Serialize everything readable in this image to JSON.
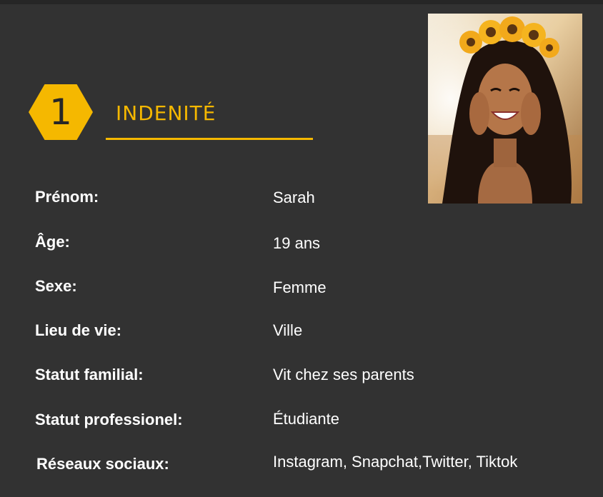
{
  "section": {
    "number": "1",
    "title": "INDENITÉ"
  },
  "colors": {
    "background": "#323232",
    "accent": "#f5b800",
    "text": "#ffffff"
  },
  "photo": {
    "icon": "portrait-photo-icon"
  },
  "fields": [
    {
      "label": "Prénom:",
      "value": "Sarah"
    },
    {
      "label": "Âge:",
      "value": "19 ans"
    },
    {
      "label": "Sexe:",
      "value": "Femme"
    },
    {
      "label": "Lieu de vie:",
      "value": "Ville"
    },
    {
      "label": "Statut familial:",
      "value": "Vit chez ses parents"
    },
    {
      "label": "Statut professionel:",
      "value": "Étudiante"
    },
    {
      "label": "Réseaux sociaux:",
      "value": "Instagram, Snapchat,Twitter, Tiktok"
    }
  ]
}
